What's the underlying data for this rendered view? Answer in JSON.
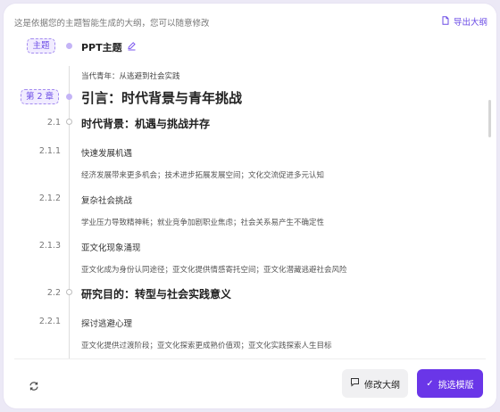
{
  "header": {
    "hint": "这是依据您的主题智能生成的大纲，您可以随意修改",
    "export_label": "导出大纲"
  },
  "topic": {
    "badge": "主题",
    "title": "PPT主题",
    "subtitle": "当代青年：从逃避到社会实践"
  },
  "chapter": {
    "badge": "第 2 章",
    "title": "引言：时代背景与青年挑战"
  },
  "sections": [
    {
      "num": "2.1",
      "title": "时代背景：机遇与挑战并存",
      "points": [
        {
          "num": "2.1.1",
          "title": "快速发展机遇",
          "detail": "经济发展带来更多机会；技术进步拓展发展空间；文化交流促进多元认知"
        },
        {
          "num": "2.1.2",
          "title": "复杂社会挑战",
          "detail": "学业压力导致精神耗；就业竞争加剧职业焦虑；社会关系易产生不确定性"
        },
        {
          "num": "2.1.3",
          "title": "亚文化现象涌现",
          "detail": "亚文化成为身份认同途径；亚文化提供情感寄托空间；亚文化潜藏逃避社会风险"
        }
      ]
    },
    {
      "num": "2.2",
      "title": "研究目的：转型与社会实践意义",
      "points": [
        {
          "num": "2.2.1",
          "title": "探讨逃避心理",
          "detail": "亚文化提供过渡阶段；亚文化探索更成熟价值观；亚文化实践探索人生目标"
        }
      ]
    }
  ],
  "footer": {
    "modify_label": "修改大纲",
    "template_label": "挑选模版",
    "template_check": "✓"
  },
  "colors": {
    "accent": "#6a36e8",
    "badge_bg": "#f1ecff",
    "badge_border": "#a48cf0"
  }
}
